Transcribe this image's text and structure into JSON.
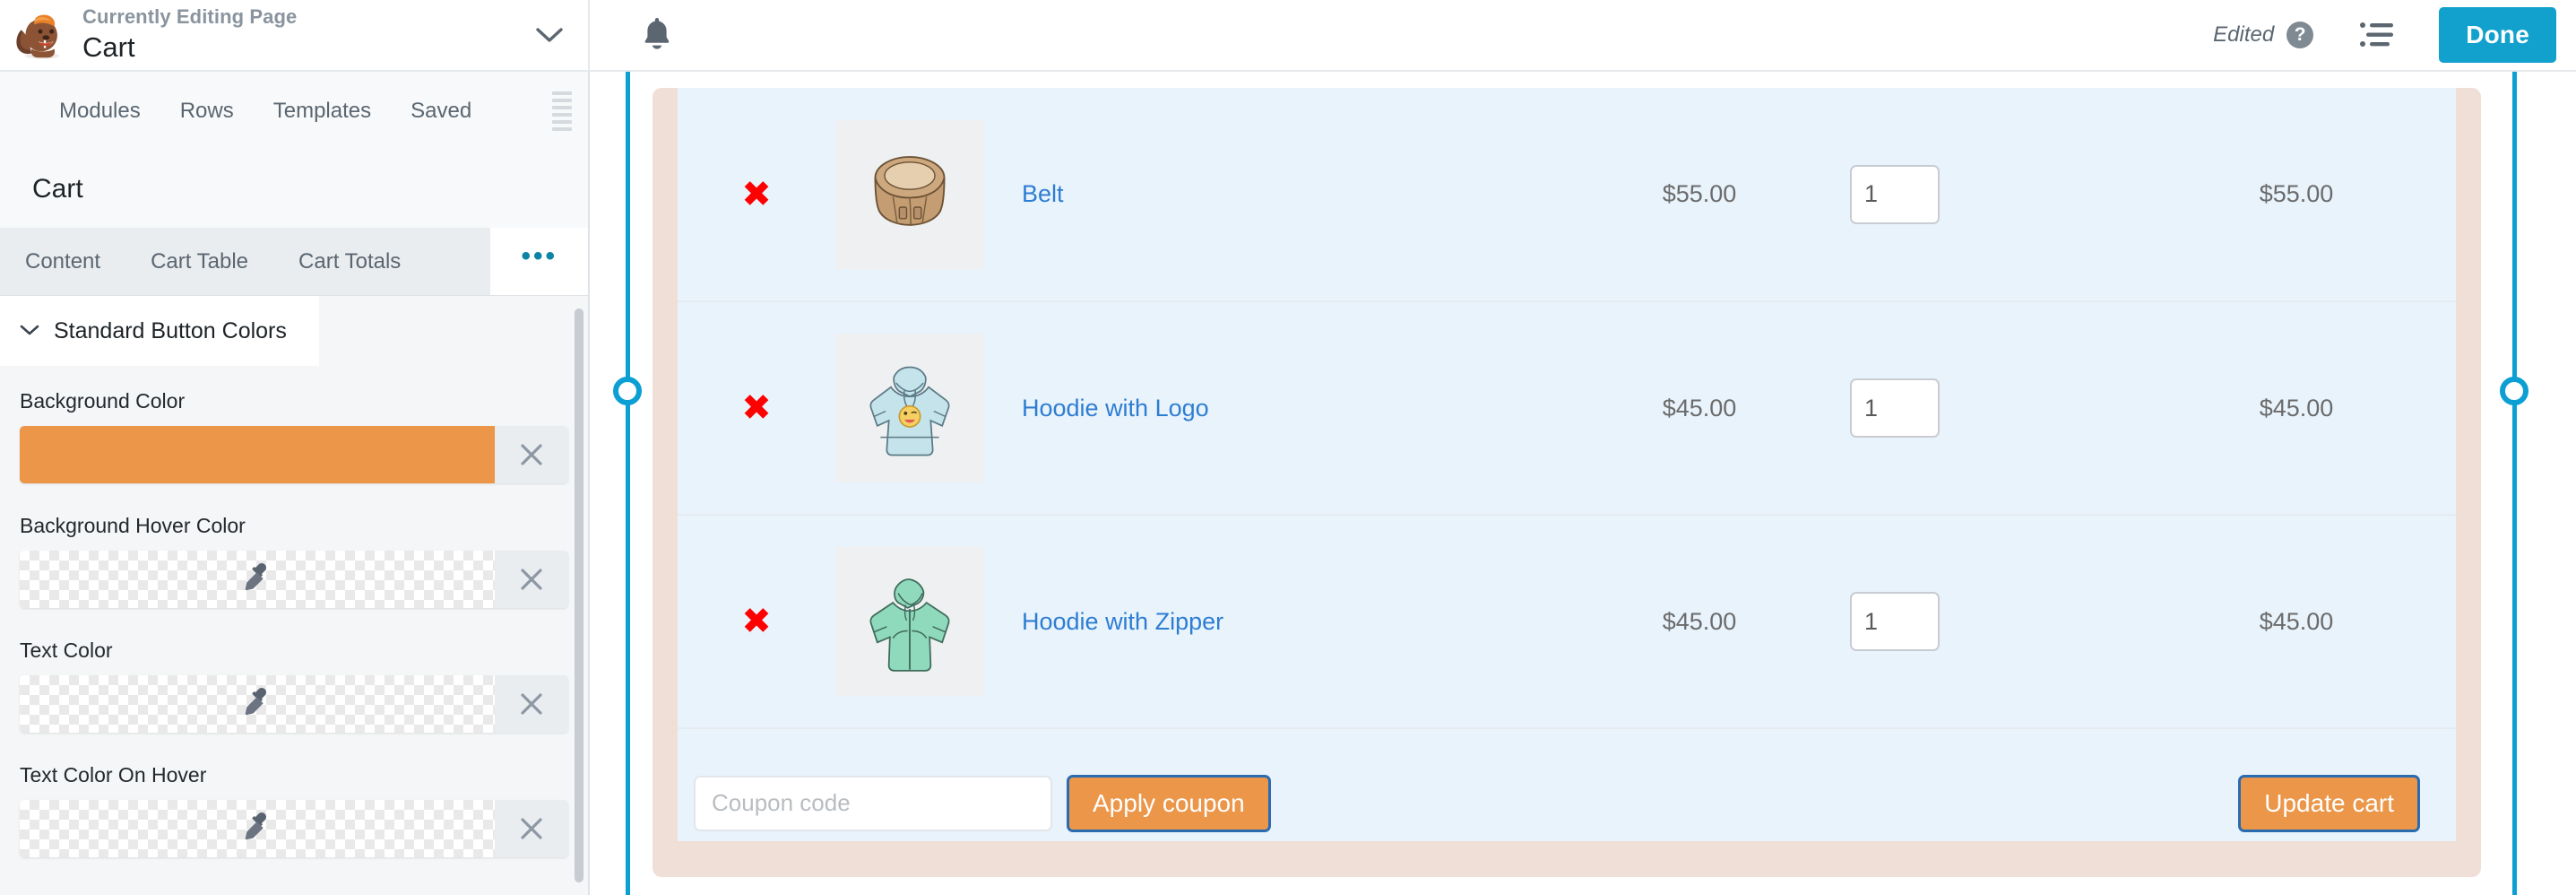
{
  "topbar": {
    "logo_icon": "beaver-builder-logo",
    "eyebrow": "Currently Editing Page",
    "title": "Cart",
    "caret_icon": "chevron-down-icon",
    "bell_icon": "bell-icon",
    "edited_label": "Edited",
    "help_icon": "help-question-icon",
    "help_glyph": "?",
    "outline_icon": "outline-list-icon",
    "done_label": "Done",
    "done_color": "#12a0cd"
  },
  "sidebar": {
    "nav": [
      {
        "label": "Modules"
      },
      {
        "label": "Rows"
      },
      {
        "label": "Templates"
      },
      {
        "label": "Saved"
      }
    ],
    "drag_handle_icon": "drag-handle-icon",
    "module_title": "Cart",
    "tabs": [
      {
        "label": "Content",
        "active": true
      },
      {
        "label": "Cart Table",
        "active": false
      },
      {
        "label": "Cart Totals",
        "active": false
      }
    ],
    "more_tab": {
      "label": "•••",
      "name": "more-tabs"
    },
    "section": {
      "chevron_icon": "chevron-down-icon",
      "title": "Standard Button Colors"
    },
    "fields": [
      {
        "label": "Background Color",
        "type": "solid",
        "value": "#eb9649",
        "eyedropper_icon": "eyedropper-icon",
        "clear_icon": "close-x-icon"
      },
      {
        "label": "Background Hover Color",
        "type": "transparent",
        "value": "",
        "eyedropper_icon": "eyedropper-icon",
        "clear_icon": "close-x-icon"
      },
      {
        "label": "Text Color",
        "type": "transparent",
        "value": "",
        "eyedropper_icon": "eyedropper-icon",
        "clear_icon": "close-x-icon"
      },
      {
        "label": "Text Color On Hover",
        "type": "transparent",
        "value": "",
        "eyedropper_icon": "eyedropper-icon",
        "clear_icon": "close-x-icon"
      }
    ],
    "scrollbar_name": "sidebar-scrollbar"
  },
  "canvas": {
    "rail_color": "#0b9fd4",
    "row_highlight_color": "#f0dfd7",
    "cart_bg_color": "#e9f3fc",
    "rows": [
      {
        "remove_icon": "remove-item-x-icon",
        "thumb_icon": "belt-thumbnail",
        "name": "Belt",
        "price": "$55.00",
        "qty": "1",
        "subtotal": "$55.00"
      },
      {
        "remove_icon": "remove-item-x-icon",
        "thumb_icon": "hoodie-with-logo-thumbnail",
        "name": "Hoodie with Logo",
        "price": "$45.00",
        "qty": "1",
        "subtotal": "$45.00"
      },
      {
        "remove_icon": "remove-item-x-icon",
        "thumb_icon": "hoodie-with-zipper-thumbnail",
        "name": "Hoodie with Zipper",
        "price": "$45.00",
        "qty": "1",
        "subtotal": "$45.00"
      }
    ],
    "footer": {
      "coupon_value": "",
      "coupon_placeholder": "Coupon code",
      "apply_label": "Apply coupon",
      "update_label": "Update cart",
      "button_bg": "#eb9649",
      "button_outline": "#2b6cb0"
    }
  }
}
